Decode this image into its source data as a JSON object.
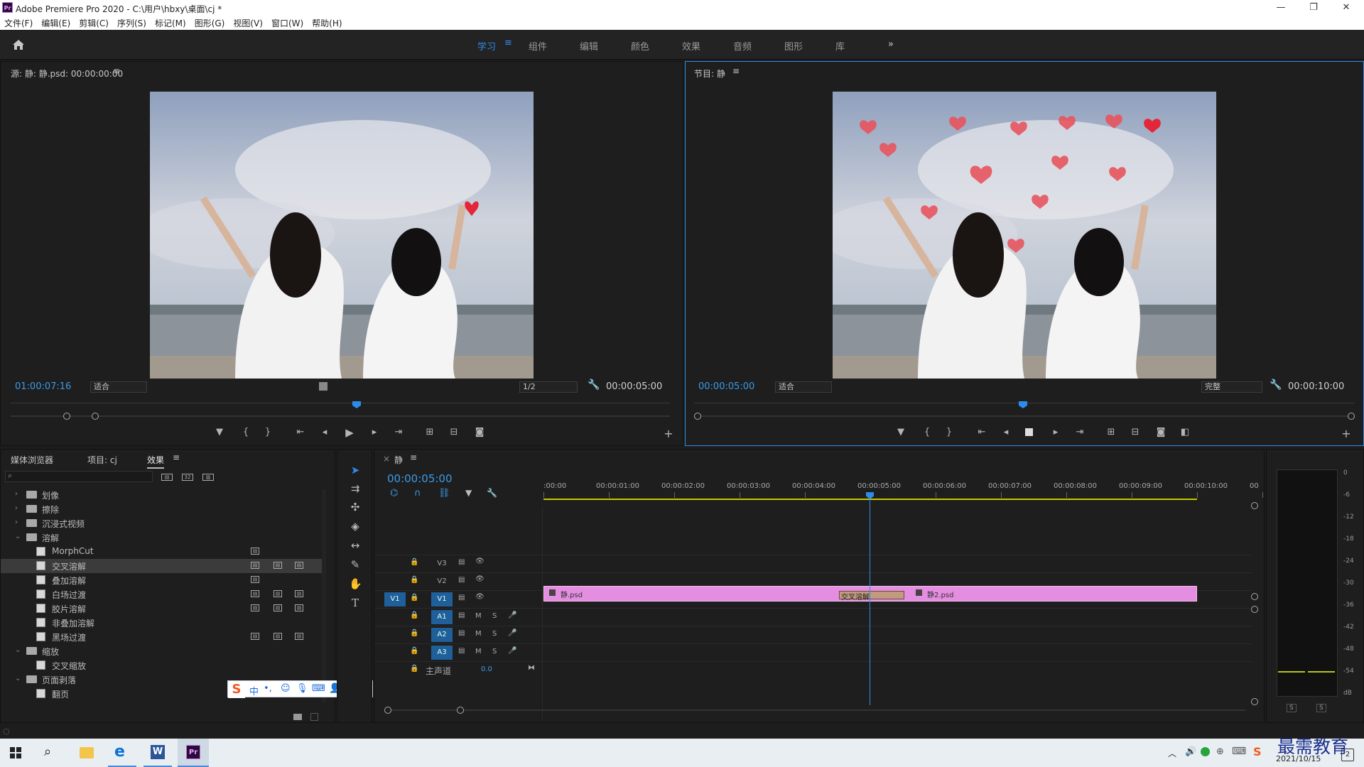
{
  "titlebar": {
    "app_short": "Pr",
    "title": "Adobe Premiere Pro 2020 - C:\\用户\\hbxy\\桌面\\cj *"
  },
  "menu": [
    "文件(F)",
    "编辑(E)",
    "剪辑(C)",
    "序列(S)",
    "标记(M)",
    "图形(G)",
    "视图(V)",
    "窗口(W)",
    "帮助(H)"
  ],
  "workspaces": [
    "学习",
    "组件",
    "编辑",
    "颜色",
    "效果",
    "音频",
    "图形",
    "库"
  ],
  "workspace_more": "»",
  "source": {
    "title": "源: 静: 静.psd: 00:00:00:00",
    "timecode": "01:00:07:16",
    "fit": "适合",
    "resolution": "1/2",
    "duration": "00:00:05:00"
  },
  "program": {
    "title": "节目: 静",
    "timecode": "00:00:05:00",
    "fit": "适合",
    "quality": "完整",
    "duration": "00:00:10:00"
  },
  "left_tabs": [
    "媒体浏览器",
    "项目: cj",
    "效果"
  ],
  "effects_tree": [
    {
      "type": "folder",
      "label": "划像",
      "open": false,
      "indent": 0
    },
    {
      "type": "folder",
      "label": "擦除",
      "open": false,
      "indent": 0
    },
    {
      "type": "folder",
      "label": "沉浸式视频",
      "open": false,
      "indent": 0
    },
    {
      "type": "folder",
      "label": "溶解",
      "open": true,
      "indent": 0
    },
    {
      "type": "fx",
      "label": "MorphCut",
      "badges": 1,
      "indent": 1
    },
    {
      "type": "fx",
      "label": "交叉溶解",
      "badges": 3,
      "indent": 1,
      "selected": true
    },
    {
      "type": "fx",
      "label": "叠加溶解",
      "badges": 1,
      "indent": 1
    },
    {
      "type": "fx",
      "label": "白场过渡",
      "badges": 3,
      "indent": 1
    },
    {
      "type": "fx",
      "label": "胶片溶解",
      "badges": 3,
      "indent": 1
    },
    {
      "type": "fx",
      "label": "非叠加溶解",
      "badges": 0,
      "indent": 1
    },
    {
      "type": "fx",
      "label": "黑场过渡",
      "badges": 3,
      "indent": 1
    },
    {
      "type": "folder",
      "label": "缩放",
      "open": true,
      "indent": 0
    },
    {
      "type": "fx",
      "label": "交叉缩放",
      "badges": 0,
      "indent": 1
    },
    {
      "type": "folder",
      "label": "页面剥落",
      "open": true,
      "indent": 0
    },
    {
      "type": "fx",
      "label": "翻页",
      "badges": 0,
      "indent": 1
    },
    {
      "type": "fx",
      "label": "页面剥落",
      "badges": 0,
      "indent": 1
    }
  ],
  "timeline": {
    "tab": "静",
    "timecode": "00:00:05:00",
    "ruler": [
      ":00:00",
      "00:00:01:00",
      "00:00:02:00",
      "00:00:03:00",
      "00:00:04:00",
      "00:00:05:00",
      "00:00:06:00",
      "00:00:07:00",
      "00:00:08:00",
      "00:00:09:00",
      "00:00:10:00",
      "00"
    ],
    "video_tracks": [
      "V3",
      "V2",
      "V1"
    ],
    "audio_tracks": [
      "A1",
      "A2",
      "A3"
    ],
    "source_patch": "V1",
    "master_label": "主声道",
    "master_value": "0.0",
    "clip1": "静.psd",
    "clip2": "静2.psd",
    "transition": "交叉溶解",
    "ms": {
      "m": "M",
      "s": "S"
    }
  },
  "meter_scale": [
    "0",
    "-6",
    "-12",
    "-18",
    "-24",
    "-30",
    "-36",
    "-42",
    "-48",
    "-54",
    "dB"
  ],
  "meter_solo": [
    "S",
    "S"
  ],
  "ime": {
    "lang": "中"
  },
  "watermark": "最需教育",
  "clock": {
    "date": "2021/10/15",
    "notif_count": "2"
  },
  "colors": {
    "accent": "#2d8ceb",
    "clip": "#e58de0",
    "transition": "#c19a7f",
    "playhead": "#2d8ceb"
  }
}
